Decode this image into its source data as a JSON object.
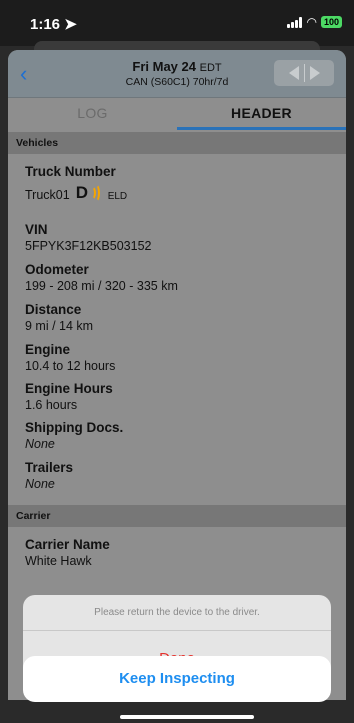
{
  "status_bar": {
    "time": "1:16",
    "battery": "100"
  },
  "header": {
    "date": "Fri May 24",
    "timezone": "EDT",
    "ruleset": "CAN (S60C1) 70hr/7d"
  },
  "tabs": [
    {
      "label": "LOG",
      "active": false
    },
    {
      "label": "HEADER",
      "active": true
    }
  ],
  "sections": {
    "vehicles": "Vehicles",
    "carrier": "Carrier"
  },
  "vehicles": {
    "truck_number": {
      "label": "Truck Number",
      "value": "Truck01",
      "eld_tag": "ELD"
    },
    "vin": {
      "label": "VIN",
      "value": "5FPYK3F12KB503152"
    },
    "odometer": {
      "label": "Odometer",
      "value": "199 - 208 mi / 320 - 335 km"
    },
    "distance": {
      "label": "Distance",
      "value": "9 mi / 14 km"
    },
    "engine": {
      "label": "Engine",
      "value": "10.4 to 12 hours"
    },
    "engine_hours": {
      "label": "Engine Hours",
      "value": "1.6 hours"
    },
    "shipping_docs": {
      "label": "Shipping Docs.",
      "value": "None"
    },
    "trailers": {
      "label": "Trailers",
      "value": "None"
    }
  },
  "carrier": {
    "carrier_name": {
      "label": "Carrier Name",
      "value": "White Hawk"
    }
  },
  "action_sheet": {
    "message": "Please return the device to the driver.",
    "done_label": "Done",
    "keep_label": "Keep Inspecting"
  },
  "colors": {
    "accent_blue": "#1e8ef0",
    "destructive_red": "#e5322d",
    "eld_orange": "#f5a500",
    "tab_underline": "#2a72b8"
  }
}
